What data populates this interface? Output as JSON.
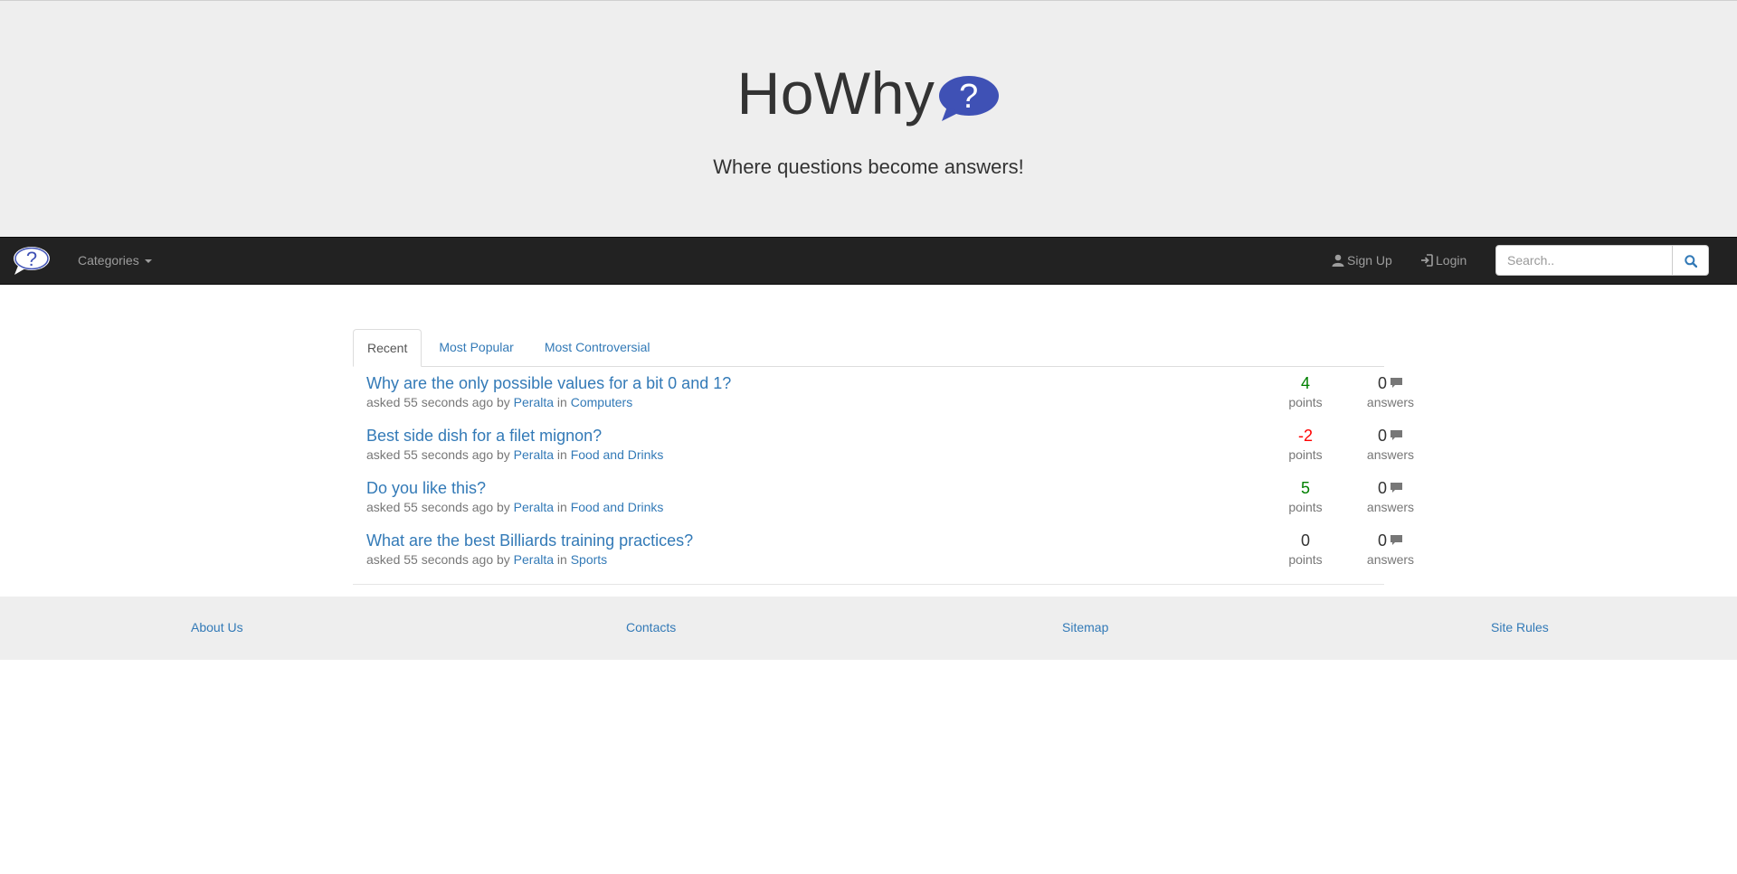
{
  "header": {
    "title": "HoWhy",
    "logo_glyph": "?",
    "tagline": "Where questions become answers!"
  },
  "navbar": {
    "categories_label": "Categories",
    "signup_label": "Sign Up",
    "login_label": "Login",
    "search_placeholder": "Search..",
    "search_value": ""
  },
  "tabs": [
    {
      "label": "Recent",
      "active": true
    },
    {
      "label": "Most Popular",
      "active": false
    },
    {
      "label": "Most Controversial",
      "active": false
    }
  ],
  "questions": [
    {
      "title": "Why are the only possible values for a bit 0 and 1?",
      "asked": "asked 55 seconds ago by",
      "author": "Peralta",
      "in_text": "in",
      "category": "Computers",
      "points": "4",
      "points_label": "points",
      "answers": "0",
      "answers_label": "answers"
    },
    {
      "title": "Best side dish for a filet mignon?",
      "asked": "asked 55 seconds ago by",
      "author": "Peralta",
      "in_text": "in",
      "category": "Food and Drinks",
      "points": "-2",
      "points_label": "points",
      "answers": "0",
      "answers_label": "answers"
    },
    {
      "title": "Do you like this?",
      "asked": "asked 55 seconds ago by",
      "author": "Peralta",
      "in_text": "in",
      "category": "Food and Drinks",
      "points": "5",
      "points_label": "points",
      "answers": "0",
      "answers_label": "answers"
    },
    {
      "title": "What are the best Billiards training practices?",
      "asked": "asked 55 seconds ago by",
      "author": "Peralta",
      "in_text": "in",
      "category": "Sports",
      "points": "0",
      "points_label": "points",
      "answers": "0",
      "answers_label": "answers"
    }
  ],
  "footer": {
    "about": "About Us",
    "contacts": "Contacts",
    "sitemap": "Sitemap",
    "rules": "Site Rules"
  },
  "colors": {
    "positive": "#008000",
    "negative": "#ff0000",
    "bubble": "#3f51b5",
    "link": "#337ab7"
  }
}
